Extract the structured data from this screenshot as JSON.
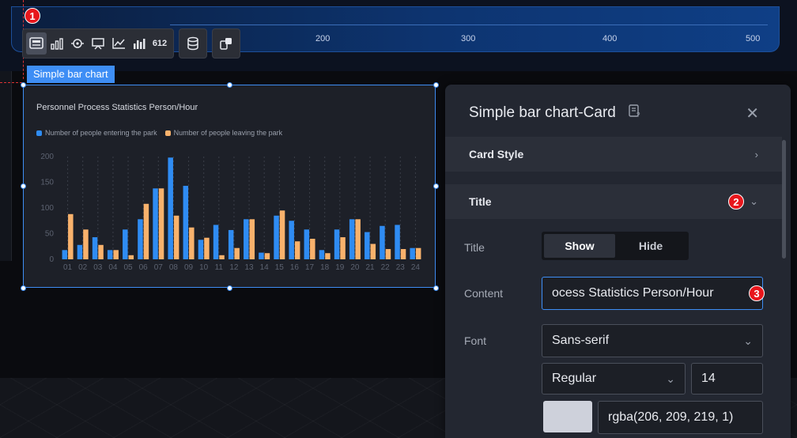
{
  "ruler": {
    "ticks": [
      "200",
      "300",
      "400",
      "500"
    ]
  },
  "badges": {
    "b1": "1",
    "b2": "2",
    "b3": "3"
  },
  "toolbar": {
    "icons": [
      "image-card-icon",
      "bar-chart-icon",
      "radar-chart-icon",
      "pie-chart-icon",
      "line-chart-icon",
      "column-chart-icon",
      "number-card-icon",
      "database-icon",
      "component-icon"
    ],
    "number_label": "612"
  },
  "chart_tag": "Simple bar chart",
  "chart_data": {
    "type": "bar",
    "title": "Personnel Process Statistics Person/Hour",
    "categories": [
      "01",
      "02",
      "03",
      "04",
      "05",
      "06",
      "07",
      "08",
      "09",
      "10",
      "11",
      "12",
      "13",
      "14",
      "15",
      "16",
      "17",
      "18",
      "19",
      "20",
      "21",
      "22",
      "23",
      "24"
    ],
    "series": [
      {
        "name": "Number of people entering the park",
        "color": "#2f8cf3",
        "values": [
          18,
          28,
          43,
          18,
          58,
          78,
          138,
          198,
          143,
          38,
          67,
          57,
          78,
          13,
          85,
          75,
          58,
          18,
          58,
          78,
          53,
          65,
          67,
          22
        ]
      },
      {
        "name": "Number of people leaving the park",
        "color": "#f9b26c",
        "values": [
          88,
          58,
          28,
          18,
          8,
          108,
          138,
          85,
          62,
          42,
          8,
          22,
          78,
          12,
          95,
          35,
          40,
          12,
          43,
          78,
          30,
          20,
          20,
          22
        ]
      }
    ],
    "ylim": [
      0,
      200
    ],
    "yticks": [
      "0",
      "50",
      "100",
      "150",
      "200"
    ],
    "grid": true,
    "legend": "top-left"
  },
  "panel": {
    "title": "Simple bar chart-Card",
    "sections": {
      "card_style": "Card Style",
      "title": "Title"
    },
    "fields": {
      "title_label": "Title",
      "show": "Show",
      "hide": "Hide",
      "content_label": "Content",
      "content_value": "ocess Statistics Person/Hour",
      "font_label": "Font",
      "font_family": "Sans-serif",
      "font_weight": "Regular",
      "font_size": "14",
      "color_value": "rgba(206, 209, 219, 1)"
    }
  }
}
